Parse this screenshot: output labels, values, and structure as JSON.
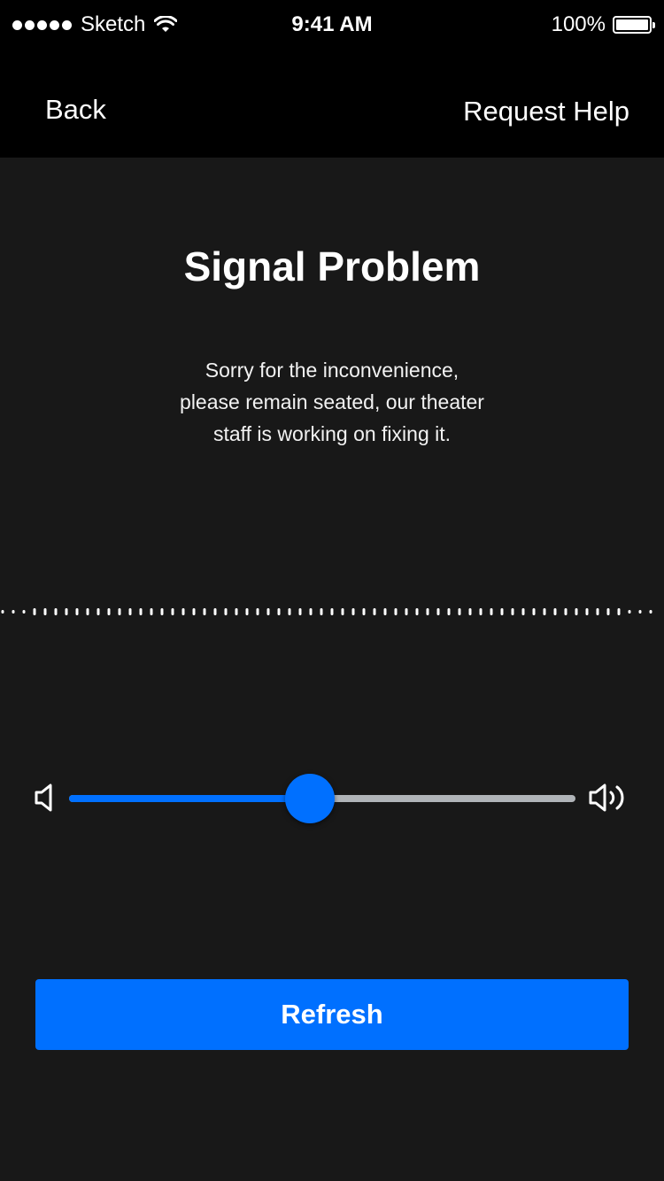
{
  "status_bar": {
    "carrier": "Sketch",
    "time": "9:41 AM",
    "battery": "100%"
  },
  "nav": {
    "back_label": "Back",
    "help_label": "Request Help"
  },
  "main": {
    "title": "Signal Problem",
    "message_lines": [
      "Sorry for the inconvenience,",
      "please remain seated, our theater",
      "staff is working on fixing it."
    ]
  },
  "volume": {
    "level": 0.475,
    "low_icon": "volume-mute-icon",
    "high_icon": "volume-high-icon"
  },
  "actions": {
    "refresh_label": "Refresh"
  },
  "colors": {
    "accent": "#0070ff",
    "background": "#181818",
    "bar": "#000000"
  }
}
